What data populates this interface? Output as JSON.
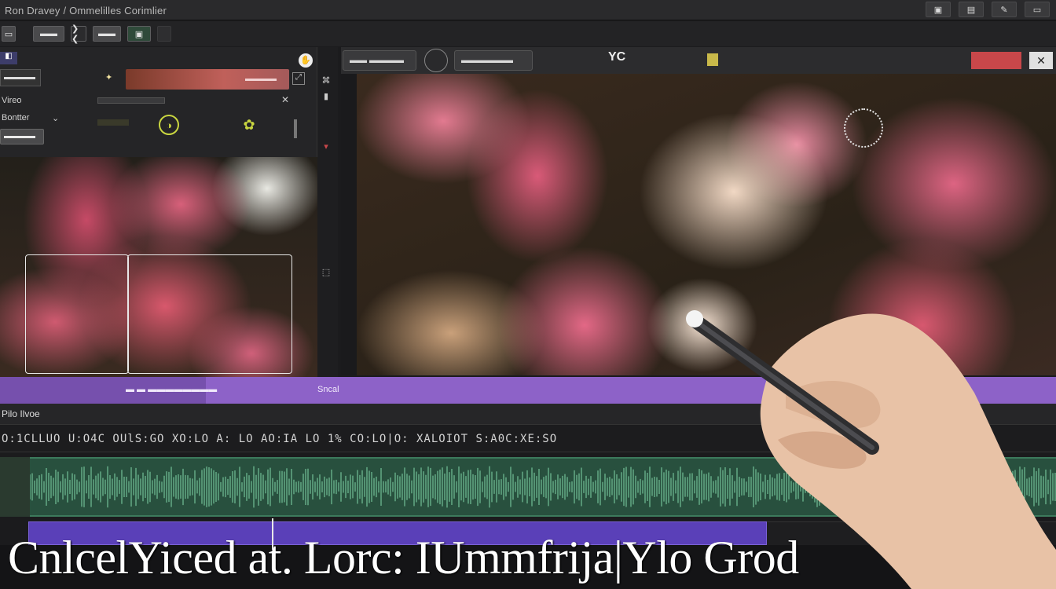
{
  "app": {
    "title": "Ron Dravey / Ommelilles Corimlier"
  },
  "window_controls": [
    "▣",
    "▤",
    "✎",
    "▭"
  ],
  "toolbar": {
    "buttons": [
      "▭",
      "▬▬",
      "❯❮",
      "▬▬",
      "▣"
    ]
  },
  "left_panel": {
    "tab_icon": "◧",
    "field_value": "▬▬▬▬",
    "gradient_label": "▬▬▬▬",
    "row1_label": "Vireo",
    "row2_label": "Bontter",
    "button_label": "▬▬▬▬",
    "knob1": "◑",
    "knob2": "✿"
  },
  "preview": {
    "seg1_label": "▬▬  ▬▬▬▬",
    "seg2_label": "▬▬▬▬▬▬",
    "icon_center": "YC",
    "close_label": "✕"
  },
  "range_bar": {
    "left_label": "▬ ▬  ▬▬▬▬▬▬▬▬",
    "mid_label": "Sncal"
  },
  "timeline": {
    "title": "Pilo Ilvoe",
    "ruler": "O:1CLLUO U:O4C OUlS:GO  XO:LO  A: LO AO:IA LO 1% CO:LO|O: XALOIOT S:A0C:XE:SO"
  },
  "caption": {
    "text": "CnlcelYiced at. Lorc: IUmmfrija|Ylo Grod"
  },
  "colors": {
    "accent_purple": "#8d62c8",
    "track_green": "#28503e",
    "video_track": "#5a40b8",
    "alert_red": "#c9474a"
  },
  "icons": {
    "close": "close-icon",
    "knob": "dial-icon",
    "flower": "flower-icon",
    "dotted": "focus-ring-icon",
    "stylus": "stylus-icon"
  }
}
